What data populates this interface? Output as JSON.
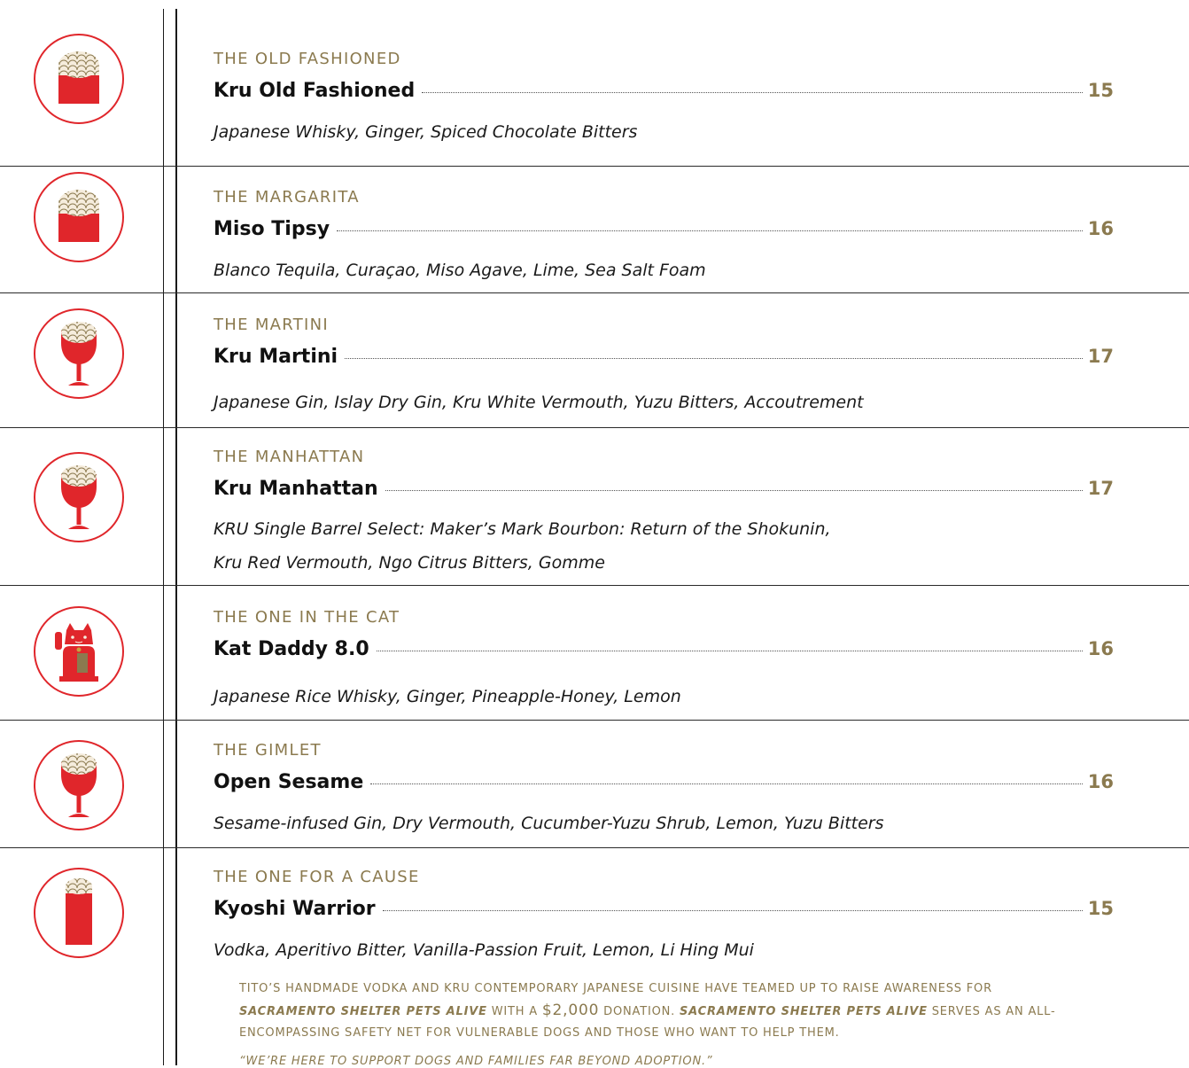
{
  "colors": {
    "accent_red": "#e0262b",
    "gold": "#8b7a4f",
    "text": "#111111"
  },
  "items": [
    {
      "category": "THE OLD FASHIONED",
      "name": "Kru Old Fashioned",
      "price": "15",
      "ingredients": [
        "Japanese Whisky, Ginger, Spiced Chocolate Bitters"
      ],
      "icon": "rocks-glass-icon"
    },
    {
      "category": "THE MARGARITA",
      "name": "Miso Tipsy",
      "price": "16",
      "ingredients": [
        "Blanco Tequila, Curaçao, Miso Agave, Lime, Sea Salt Foam"
      ],
      "icon": "rocks-glass-icon"
    },
    {
      "category": "THE MARTINI",
      "name": "Kru Martini",
      "price": "17",
      "ingredients": [
        "Japanese Gin, Islay Dry Gin, Kru White Vermouth, Yuzu Bitters, Accoutrement"
      ],
      "icon": "wine-glass-icon"
    },
    {
      "category": "THE MANHATTAN",
      "name": "Kru Manhattan",
      "price": "17",
      "ingredients": [
        "KRU Single Barrel Select: Maker’s Mark Bourbon: Return of the Shokunin,",
        "Kru Red Vermouth, Ngo Citrus Bitters, Gomme"
      ],
      "icon": "wine-glass-icon"
    },
    {
      "category": "THE ONE IN THE CAT",
      "name": "Kat Daddy 8.0",
      "price": "16",
      "ingredients": [
        "Japanese Rice Whisky, Ginger, Pineapple-Honey, Lemon"
      ],
      "icon": "lucky-cat-icon"
    },
    {
      "category": "THE GIMLET",
      "name": "Open Sesame",
      "price": "16",
      "ingredients": [
        "Sesame-infused Gin, Dry Vermouth, Cucumber-Yuzu Shrub, Lemon, Yuzu Bitters"
      ],
      "icon": "wine-glass-icon"
    },
    {
      "category": "THE ONE FOR A CAUSE",
      "name": "Kyoshi Warrior",
      "price": "15",
      "ingredients": [
        "Vodka, Aperitivo Bitter, Vanilla-Passion Fruit, Lemon, Li Hing Mui"
      ],
      "icon": "highball-glass-icon"
    }
  ],
  "cause": {
    "part1": "tito’s handmade vodka and kru contemporary japanese cuisine have teamed up to raise awareness for ",
    "org1": "sacramento shelter pets alive",
    "part2": " with a ",
    "amount": "$2,000",
    "part3": " donation. ",
    "org2": "sacramento shelter pets alive",
    "part4": " serves as an all-encompassing safety net for vulnerable dogs and those who want to help them.",
    "quote": "“we’re here to support dogs and families far beyond adoption.”"
  }
}
